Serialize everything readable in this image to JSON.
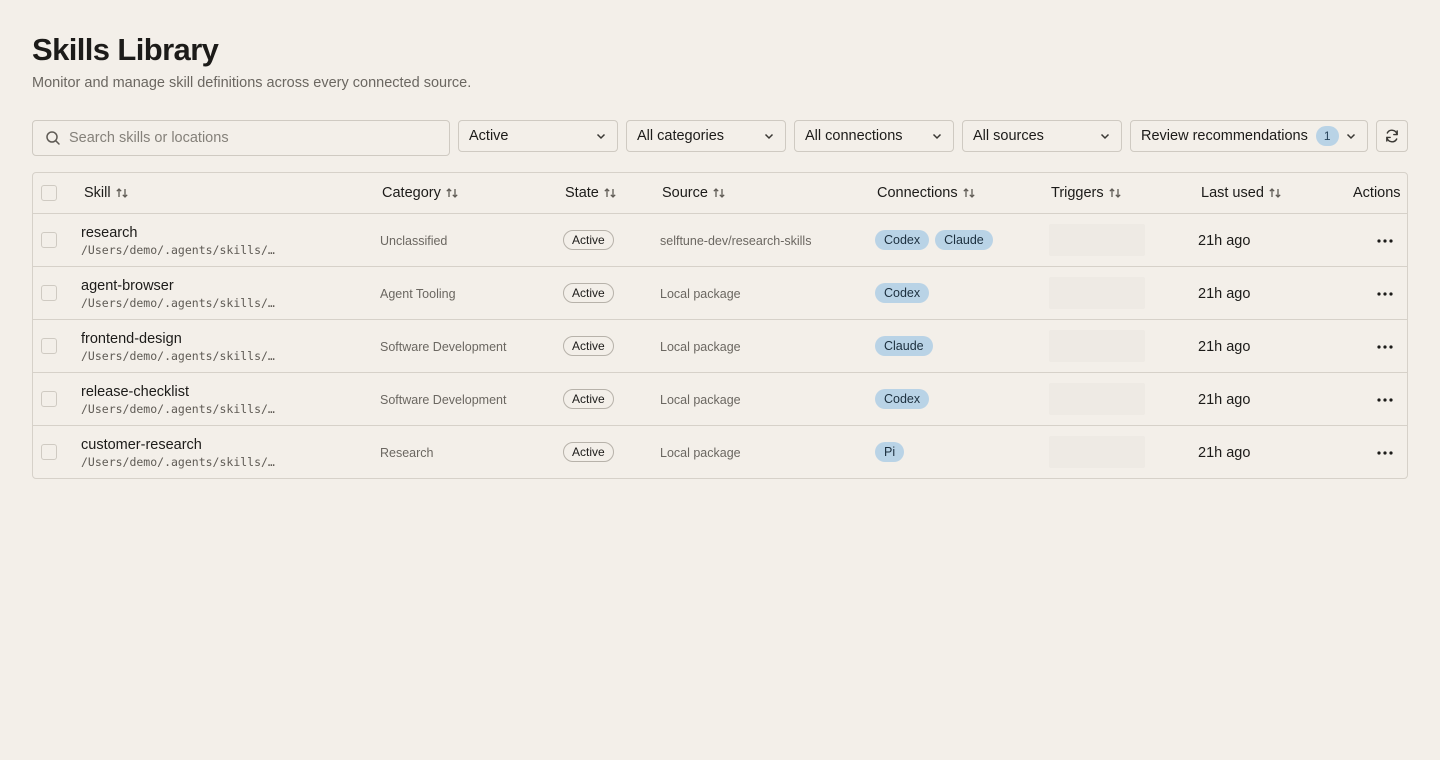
{
  "header": {
    "title": "Skills Library",
    "subtitle": "Monitor and manage skill definitions across every connected source."
  },
  "toolbar": {
    "search_placeholder": "Search skills or locations",
    "search_icon": "search-icon",
    "filters": {
      "state": "Active",
      "category": "All categories",
      "connection": "All connections",
      "source": "All sources"
    },
    "review": {
      "label": "Review recommendations",
      "count": "1"
    },
    "refresh_icon": "refresh-icon"
  },
  "table": {
    "columns": {
      "skill": "Skill",
      "category": "Category",
      "state": "State",
      "source": "Source",
      "connections": "Connections",
      "triggers": "Triggers",
      "last_used": "Last used",
      "actions": "Actions"
    },
    "rows": [
      {
        "name": "research",
        "path": "/Users/demo/.agents/skills/…",
        "category": "Unclassified",
        "state": "Active",
        "source": "selftune-dev/research-skills",
        "connections": [
          "Codex",
          "Claude"
        ],
        "last_used": "21h ago"
      },
      {
        "name": "agent-browser",
        "path": "/Users/demo/.agents/skills/…",
        "category": "Agent Tooling",
        "state": "Active",
        "source": "Local package",
        "connections": [
          "Codex"
        ],
        "last_used": "21h ago"
      },
      {
        "name": "frontend-design",
        "path": "/Users/demo/.agents/skills/…",
        "category": "Software Development",
        "state": "Active",
        "source": "Local package",
        "connections": [
          "Claude"
        ],
        "last_used": "21h ago"
      },
      {
        "name": "release-checklist",
        "path": "/Users/demo/.agents/skills/…",
        "category": "Software Development",
        "state": "Active",
        "source": "Local package",
        "connections": [
          "Codex"
        ],
        "last_used": "21h ago"
      },
      {
        "name": "customer-research",
        "path": "/Users/demo/.agents/skills/…",
        "category": "Research",
        "state": "Active",
        "source": "Local package",
        "connections": [
          "Pi"
        ],
        "last_used": "21h ago"
      }
    ]
  },
  "colors": {
    "background": "#f3efe9",
    "connection_badge": "#b9d3e6",
    "text": "#1c1b19",
    "muted": "#6b6761"
  }
}
